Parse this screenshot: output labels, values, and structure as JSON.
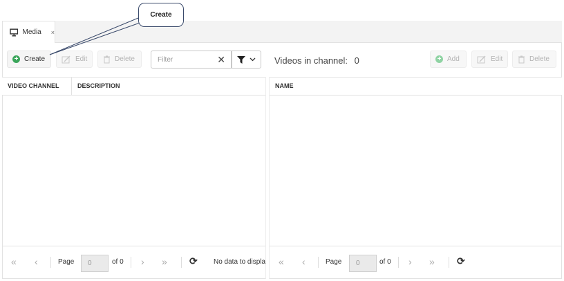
{
  "callout": {
    "text": "Create"
  },
  "tab": {
    "label": "Media",
    "close": "×"
  },
  "left_toolbar": {
    "create": "Create",
    "edit": "Edit",
    "delete": "Delete"
  },
  "filter": {
    "placeholder": "Filter"
  },
  "right_panel": {
    "title": "Videos in channel:",
    "count": "0"
  },
  "right_toolbar": {
    "add": "Add",
    "edit": "Edit",
    "delete": "Delete"
  },
  "left_grid": {
    "columns": [
      "VIDEO CHANNEL",
      "DESCRIPTION"
    ]
  },
  "right_grid": {
    "columns": [
      "NAME"
    ]
  },
  "left_pager": {
    "page_label": "Page",
    "page_value": "0",
    "of_label": "of 0",
    "status": "No data to displa"
  },
  "right_pager": {
    "page_label": "Page",
    "page_value": "0",
    "of_label": "of 0"
  },
  "colors": {
    "accent_green": "#3aa55a",
    "border": "#e2e2e2"
  }
}
